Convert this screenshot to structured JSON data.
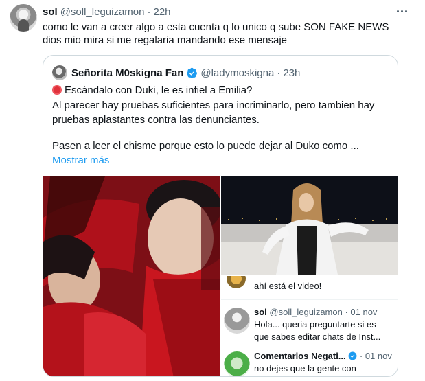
{
  "tweet": {
    "name": "sol",
    "handle": "@soll_leguizamon",
    "separator": "·",
    "time": "22h",
    "text_lines": [
      "como le van a creer algo a esta cuenta q lo unico q sube SON FAKE NEWS",
      "dios mio mira si me regalaria mandando ese mensaje"
    ]
  },
  "quote": {
    "name": "Señorita M0skigna Fan",
    "handle": "@ladymoskigna",
    "separator": "·",
    "time": "23h",
    "lines": [
      "Escándalo con Duki, le es infiel a Emilia?",
      "Al parecer hay pruebas suficientes para incriminarlo, pero tambien hay",
      "pruebas aplastantes contra las denunciantes.",
      "Pasen a leer el chisme porque esto lo puede dejar al Duko como ..."
    ],
    "show_more": "Mostrar más"
  },
  "screenshot_chat": {
    "top_line": "ahí está el video!",
    "msg1": {
      "name": "sol",
      "handle": "@soll_leguizamon · 01 nov",
      "line1": "Hola... queria preguntarte si es",
      "line2": "que sabes editar chats de Inst..."
    },
    "msg2": {
      "name": "Comentarios Negati...",
      "date": "· 01 nov",
      "line1": "no dejes que la gente con"
    }
  },
  "colors": {
    "accent": "#1d9bf0",
    "text": "#0f1419",
    "muted": "#536471",
    "border": "#cfd9de",
    "red_dot": "#e0323c"
  },
  "icons": [
    "more-icon",
    "verified-badge-icon",
    "red-circle-emoji-icon"
  ]
}
